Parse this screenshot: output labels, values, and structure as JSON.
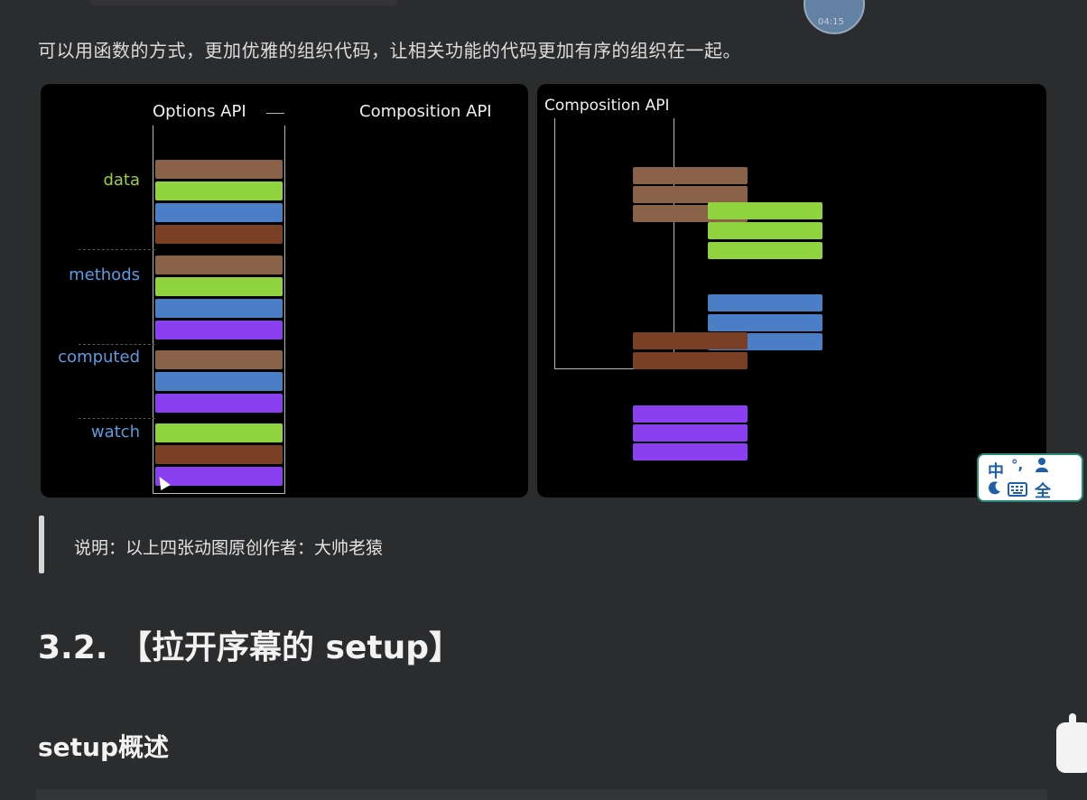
{
  "intro_text": "可以用函数的方式，更加优雅的组织代码，让相关功能的代码更加有序的组织在一起。",
  "avatar_badge": "04:15",
  "left_panel": {
    "options_api_label": "Options API",
    "composition_api_label": "Composition API",
    "sections": [
      {
        "label": "data",
        "color": "#9ccc4a"
      },
      {
        "label": "methods",
        "color": "#5b9be0"
      },
      {
        "label": "computed",
        "color": "#5b9be0"
      },
      {
        "label": "watch",
        "color": "#5b9be0"
      }
    ]
  },
  "right_panel": {
    "composition_api_label": "Composition API"
  },
  "colors": {
    "brown_light": "#8a6248",
    "brown_dark": "#7a4026",
    "green": "#8fd43f",
    "blue": "#4a7fc7",
    "purple": "#8a3ff0"
  },
  "quote_text": "说明：以上四张动图原创作者：大帅老猿",
  "heading_main": "3.2. 【拉开序幕的 setup】",
  "heading_sub": "setup概述",
  "ime_toolbar": {
    "mode_char": "中",
    "punct": "°,",
    "user_icon": "user-icon",
    "moon_icon": "moon-icon",
    "keyboard_icon": "keyboard-icon",
    "width_char": "全"
  },
  "floating_icon": "floating-widget-icon"
}
